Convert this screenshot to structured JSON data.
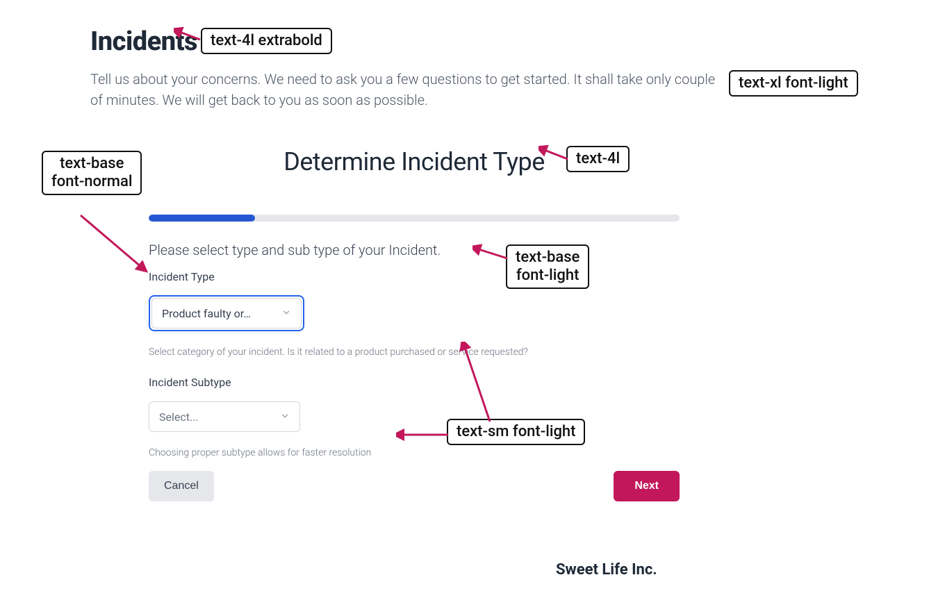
{
  "header": {
    "title": "Incidents",
    "subtitle": "Tell us about your concerns. We need to ask you a few questions to get started. It shall take only couple of minutes. We will get back to you as soon as possible."
  },
  "form": {
    "section_title": "Determine Incident Type",
    "progress_percent": 20,
    "instruction": "Please select type and sub type of your Incident.",
    "incident_type": {
      "label": "Incident Type",
      "value": "Product faulty or…",
      "helper": "Select category of your incident. Is it related to a product purchased or service requested?"
    },
    "incident_subtype": {
      "label": "Incident Subtype",
      "placeholder": "Select...",
      "helper": "Choosing proper subtype allows for faster resolution"
    },
    "buttons": {
      "cancel": "Cancel",
      "next": "Next"
    }
  },
  "footer": {
    "company": "Sweet Life Inc."
  },
  "annotations": {
    "a1": "text-4l extrabold",
    "a2": "text-xl font-light",
    "a3": "text-4l",
    "a4": "text-base\nfont-normal",
    "a5": "text-base\nfont-light",
    "a6": "text-sm font-light"
  }
}
